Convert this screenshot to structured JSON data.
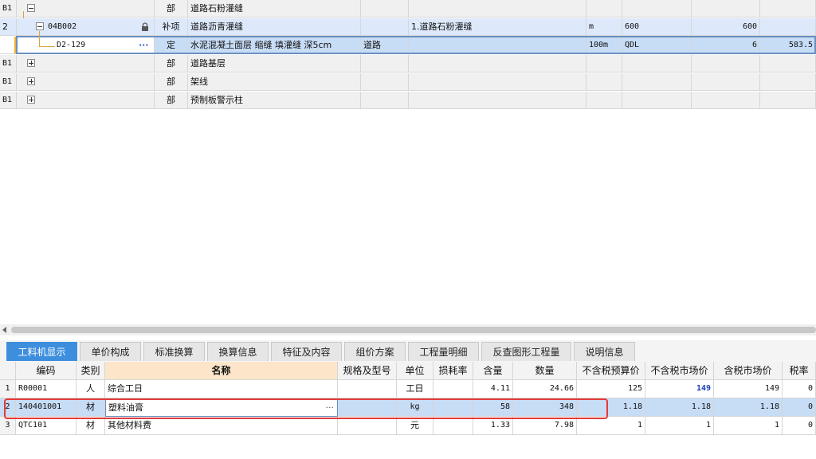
{
  "top_rows": [
    {
      "num": "B1",
      "code": "",
      "type": "部",
      "name": "道路石粉灌缝",
      "spec": "",
      "feature": "",
      "unit": "",
      "expr": "",
      "qty": "",
      "price": ""
    },
    {
      "num": "2",
      "code": "04B002",
      "type": "补项",
      "name": "道路沥青灌缝",
      "spec": "",
      "feature": "1.道路石粉灌缝",
      "unit": "m",
      "expr": "600",
      "qty": "600",
      "price": ""
    },
    {
      "num": "",
      "code": "D2-129",
      "type": "定",
      "name": "水泥混凝土面层 缩缝 填灌缝 深5cm",
      "spec": "道路",
      "feature": "",
      "unit": "100m",
      "expr": "QDL",
      "qty": "6",
      "price": "583.5"
    },
    {
      "num": "B1",
      "code": "",
      "type": "部",
      "name": "道路基层",
      "spec": "",
      "feature": "",
      "unit": "",
      "expr": "",
      "qty": "",
      "price": ""
    },
    {
      "num": "B1",
      "code": "",
      "type": "部",
      "name": "架线",
      "spec": "",
      "feature": "",
      "unit": "",
      "expr": "",
      "qty": "",
      "price": ""
    },
    {
      "num": "B1",
      "code": "",
      "type": "部",
      "name": "预制板警示柱",
      "spec": "",
      "feature": "",
      "unit": "",
      "expr": "",
      "qty": "",
      "price": ""
    }
  ],
  "tabs": [
    "工料机显示",
    "单价构成",
    "标准换算",
    "换算信息",
    "特征及内容",
    "组价方案",
    "工程量明细",
    "反查图形工程量",
    "说明信息"
  ],
  "active_tab": "工料机显示",
  "bottom_headers": [
    "编码",
    "类别",
    "名称",
    "规格及型号",
    "单位",
    "损耗率",
    "含量",
    "数量",
    "不含税预算价",
    "不含税市场价",
    "含税市场价",
    "税率"
  ],
  "bottom_rows": [
    {
      "num": "1",
      "code": "R00001",
      "cat": "人",
      "name": "综合工日",
      "spec": "",
      "unit": "工日",
      "loss": "",
      "content": "4.11",
      "qty": "24.66",
      "budget": "125",
      "market": "149",
      "tax_market": "149",
      "tax_rate": "0"
    },
    {
      "num": "2",
      "code": "140401001",
      "cat": "材",
      "name": "塑料油膏",
      "spec": "",
      "unit": "kg",
      "loss": "",
      "content": "58",
      "qty": "348",
      "budget": "1.18",
      "market": "1.18",
      "tax_market": "1.18",
      "tax_rate": "0"
    },
    {
      "num": "3",
      "code": "QTC101",
      "cat": "材",
      "name": "其他材料费",
      "spec": "",
      "unit": "元",
      "loss": "",
      "content": "1.33",
      "qty": "7.98",
      "budget": "1",
      "market": "1",
      "tax_market": "1",
      "tax_rate": "0"
    }
  ],
  "ellipsis": "···",
  "colors": {
    "accent": "#3d8fde",
    "selection": "#c7dcf5",
    "highlight_box": "#e43a3a",
    "market_price_text": "#1a3fb8"
  }
}
